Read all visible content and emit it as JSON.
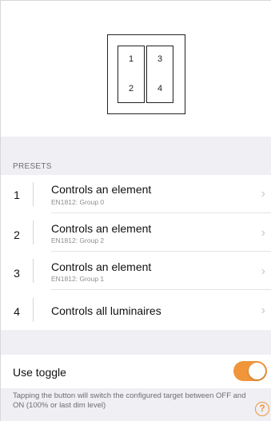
{
  "panel": {
    "rockers": [
      {
        "top": "1",
        "bottom": "2"
      },
      {
        "top": "3",
        "bottom": "4"
      }
    ]
  },
  "presets": {
    "header": "PRESETS",
    "items": [
      {
        "number": "1",
        "title": "Controls an element",
        "subtitle": "EN1812: Group 0"
      },
      {
        "number": "2",
        "title": "Controls an element",
        "subtitle": "EN1812: Group 2"
      },
      {
        "number": "3",
        "title": "Controls an element",
        "subtitle": "EN1812: Group 1"
      },
      {
        "number": "4",
        "title": "Controls all luminaires",
        "subtitle": ""
      }
    ]
  },
  "toggle": {
    "label": "Use toggle",
    "on": true,
    "color": "#f0953a",
    "description": "Tapping the button will switch the configured target between OFF and ON (100% or last dim level)"
  },
  "icons": {
    "chevron": "chevron-right-icon",
    "help": "help-icon"
  }
}
